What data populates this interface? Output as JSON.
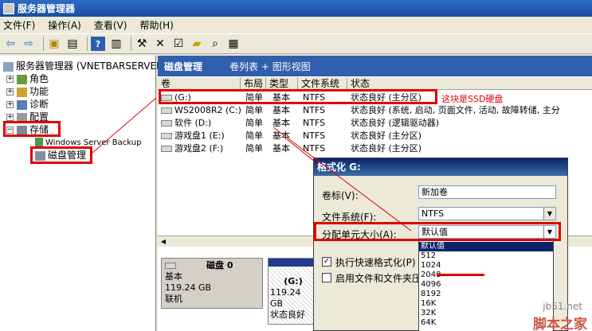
{
  "window": {
    "title": "服务器管理器"
  },
  "menu": [
    "文件(F)",
    "操作(A)",
    "查看(V)",
    "帮助(H)"
  ],
  "toolbar": {
    "icons": [
      "back-icon",
      "forward-icon",
      "up-icon",
      "list-icon",
      "help-icon",
      "properties-icon",
      "connect-icon",
      "delete-icon",
      "check-icon",
      "folder-icon",
      "search-icon",
      "view-icon"
    ]
  },
  "tree": {
    "root": "服务器管理器 (VNETBARSERVER)",
    "items": [
      "角色",
      "功能",
      "诊断",
      "配置",
      "存储"
    ],
    "storage_children": [
      "Windows Server Backup",
      "磁盘管理"
    ]
  },
  "header": {
    "title": "磁盘管理",
    "subtitle": "卷列表 + 图形视图"
  },
  "columns": [
    "卷",
    "布局",
    "类型",
    "文件系统",
    "状态"
  ],
  "volumes": [
    {
      "name": "(G:)",
      "layout": "简单",
      "type": "基本",
      "fs": "NTFS",
      "status": "状态良好 (主分区)"
    },
    {
      "name": "WS2008R2 (C:)",
      "layout": "简单",
      "type": "基本",
      "fs": "NTFS",
      "status": "状态良好 (系统, 启动, 页面文件, 活动, 故障转储, 主分"
    },
    {
      "name": "软件 (D:)",
      "layout": "简单",
      "type": "基本",
      "fs": "NTFS",
      "status": "状态良好 (逻辑驱动器)"
    },
    {
      "name": "游戏盘1 (E:)",
      "layout": "简单",
      "type": "基本",
      "fs": "NTFS",
      "status": "状态良好 (主分区)"
    },
    {
      "name": "游戏盘2 (F:)",
      "layout": "简单",
      "type": "基本",
      "fs": "NTFS",
      "status": "状态良好 (主分区)"
    }
  ],
  "annotation": "这块是SSD硬盘",
  "disk": {
    "name": "磁盘 0",
    "kind": "基本",
    "size": "119.24 GB",
    "state": "联机"
  },
  "partition": {
    "name": "(G:)",
    "size": "119.24 GB",
    "status": "状态良好"
  },
  "dialog": {
    "title": "格式化 G:",
    "volume_label": "卷标(V):",
    "volume_value": "新加卷",
    "fs_label": "文件系统(F):",
    "fs_value": "NTFS",
    "alloc_label": "分配单元大小(A):",
    "alloc_value": "默认值",
    "quick_format": "执行快速格式化(P)",
    "compression": "启用文件和文件夹压",
    "options": [
      "默认值",
      "512",
      "1024",
      "2048",
      "4096",
      "8192",
      "16K",
      "32K",
      "64K"
    ],
    "selected_option": "默认值"
  },
  "watermark": {
    "site": "jb51.net",
    "brand": "脚本之家"
  }
}
